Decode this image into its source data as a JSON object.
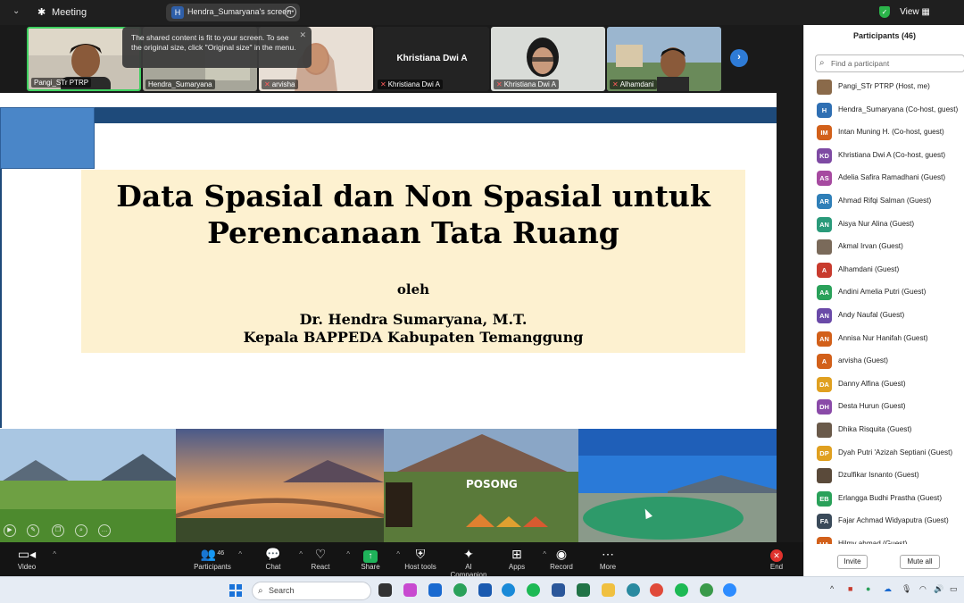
{
  "topbar": {
    "meeting_label": "Meeting",
    "screen_share_label": "Hendra_Sumaryana's screen",
    "view_label": "View"
  },
  "tooltip": {
    "text": "The shared content is fit to your screen. To see the original size, click \"Original size\" in the menu."
  },
  "video_strip": [
    {
      "name": "Pangi_STr PTRP",
      "muted": false,
      "active": true
    },
    {
      "name": "Hendra_Sumaryana",
      "muted": false
    },
    {
      "name": "arvisha",
      "muted": true
    },
    {
      "name": "Khristiana Dwi A",
      "muted": true,
      "display": "Khristiana Dwi A"
    },
    {
      "name": "Khristiana Dwi A",
      "muted": true
    },
    {
      "name": "Alhamdani",
      "muted": true
    }
  ],
  "slide": {
    "title": "Data Spasial dan Non Spasial untuk Perencanaan Tata Ruang",
    "by": "oleh",
    "author_line1": "Dr. Hendra Sumaryana, M.T.",
    "author_line2": "Kepala BAPPEDA Kabupaten Temanggung",
    "photo3_sign": "POSONG"
  },
  "toolbar": {
    "video": "Video",
    "participants": "Participants",
    "participants_count": "46",
    "chat": "Chat",
    "react": "React",
    "share": "Share",
    "host_tools": "Host tools",
    "ai_companion": "AI Companion",
    "apps": "Apps",
    "record": "Record",
    "more": "More",
    "end": "End"
  },
  "panel": {
    "title": "Participants (46)",
    "search_placeholder": "Find a participant",
    "invite": "Invite",
    "mute_all": "Mute all",
    "participants": [
      {
        "initials": "",
        "name": "Pangi_STr PTRP (Host, me)",
        "color": "#8a6a4a",
        "photo": true
      },
      {
        "initials": "H",
        "name": "Hendra_Sumaryana (Co-host, guest)",
        "color": "#2f6fb3"
      },
      {
        "initials": "IM",
        "name": "Intan Muning H. (Co-host, guest)",
        "color": "#d2601a"
      },
      {
        "initials": "KD",
        "name": "Khristiana Dwi A (Co-host, guest)",
        "color": "#7e4aa3"
      },
      {
        "initials": "AS",
        "name": "Adelia Safira Ramadhani (Guest)",
        "color": "#a64aa0"
      },
      {
        "initials": "AR",
        "name": "Ahmad Rifqi Salman (Guest)",
        "color": "#2f7fb8"
      },
      {
        "initials": "AN",
        "name": "Aisya Nur Alina (Guest)",
        "color": "#2a9a7a"
      },
      {
        "initials": "",
        "name": "Akmal Irvan (Guest)",
        "color": "#7a6a5a",
        "photo": true
      },
      {
        "initials": "A",
        "name": "Alhamdani (Guest)",
        "color": "#c83b2e"
      },
      {
        "initials": "AA",
        "name": "Andini Amelia Putri (Guest)",
        "color": "#2aa15a"
      },
      {
        "initials": "AN",
        "name": "Andy Naufal (Guest)",
        "color": "#6a4aa8"
      },
      {
        "initials": "AN",
        "name": "Annisa Nur Hanifah (Guest)",
        "color": "#d2601a"
      },
      {
        "initials": "A",
        "name": "arvisha (Guest)",
        "color": "#d2601a"
      },
      {
        "initials": "DA",
        "name": "Danny Alfina (Guest)",
        "color": "#e0a020"
      },
      {
        "initials": "DH",
        "name": "Desta Hurun (Guest)",
        "color": "#8a4aa8"
      },
      {
        "initials": "",
        "name": "Dhika Risquita (Guest)",
        "color": "#6a5a4a",
        "photo": true
      },
      {
        "initials": "DP",
        "name": "Dyah Putri 'Azizah Septiani (Guest)",
        "color": "#e0a020"
      },
      {
        "initials": "",
        "name": "Dzulfikar Isnanto (Guest)",
        "color": "#5a4a3a",
        "photo": true
      },
      {
        "initials": "EB",
        "name": "Erlangga Budhi Prastha (Guest)",
        "color": "#2aa15a"
      },
      {
        "initials": "FA",
        "name": "Fajar Achmad Widyaputra (Guest)",
        "color": "#3a4a5a"
      },
      {
        "initials": "HA",
        "name": "Hilmy ahmad (Guest)",
        "color": "#d2601a"
      }
    ]
  },
  "taskbar": {
    "search_label": "Search"
  }
}
